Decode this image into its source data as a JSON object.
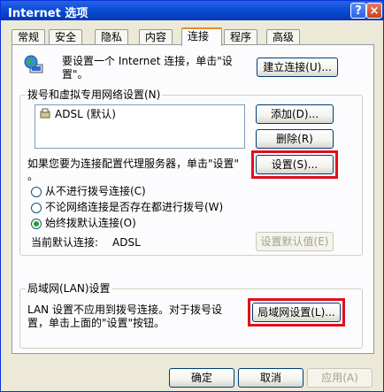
{
  "window": {
    "title": "Internet 选项",
    "help_label": "?",
    "close_label": "×"
  },
  "tabs": [
    {
      "label": "常规"
    },
    {
      "label": "安全"
    },
    {
      "label": "隐私"
    },
    {
      "label": "内容"
    },
    {
      "label": "连接",
      "active": true
    },
    {
      "label": "程序"
    },
    {
      "label": "高级"
    }
  ],
  "setup": {
    "text_line1": "要设置一个 Internet 连接，单击\"设",
    "text_line2": "置\"。",
    "button": "建立连接(U)..."
  },
  "dialup": {
    "group_label": "拨号和虚拟专用网络设置(N)",
    "connections": [
      {
        "name": "ADSL (默认)",
        "icon": "connection-icon"
      }
    ],
    "add_button": "添加(D)...",
    "delete_button": "删除(R)",
    "proxy_text": "如果您要为连接配置代理服务器，单击\"设置\"",
    "proxy_text2": "。",
    "settings_button": "设置(S)...",
    "radios": [
      {
        "label": "从不进行拨号连接(C)",
        "checked": false
      },
      {
        "label": "不论网络连接是否存在都进行拨号(W)",
        "checked": false
      },
      {
        "label": "始终拨默认连接(O)",
        "checked": true
      }
    ],
    "current_default_label": "当前默认连接:",
    "current_default_value": "ADSL",
    "set_default_button": "设置默认值(E)"
  },
  "lan": {
    "group_label": "局域网(LAN)设置",
    "text_line1": "LAN 设置不应用到拨号连接。对于拨号设",
    "text_line2": "置，单击上面的\"设置\"按钮。",
    "button": "局域网设置(L)..."
  },
  "footer": {
    "ok": "确定",
    "cancel": "取消",
    "apply": "应用(A)"
  },
  "colors": {
    "highlight": "#e0101a",
    "titlebar": "#0a4ed6",
    "active_tab_accent": "#e68b2c"
  }
}
